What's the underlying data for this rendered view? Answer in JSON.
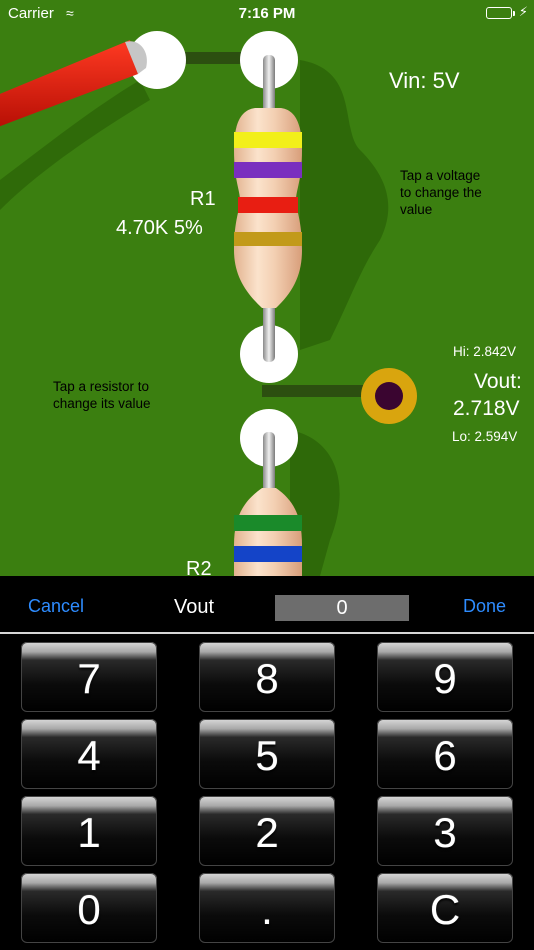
{
  "status_bar": {
    "carrier": "Carrier",
    "time": "7:16 PM",
    "battery_color": "#4cd964"
  },
  "board": {
    "background_color": "#3b7f10",
    "vin_label": "Vin: 5V",
    "vin_hint": [
      "Tap a voltage",
      "to change the",
      "value"
    ],
    "r1": {
      "name": "R1",
      "value": "4.70K 5%",
      "bands": [
        "#f2ef1a",
        "#7a2fbf",
        "#e81e12",
        "#c29a1a"
      ]
    },
    "r2": {
      "name": "R2",
      "bands": [
        "#1a8a2a",
        "#1444c8"
      ]
    },
    "resistor_hint": [
      "Tap a resistor to",
      "change its value"
    ],
    "vout": {
      "hi": "Hi: 2.842V",
      "label": "Vout:",
      "value": "2.718V",
      "lo": "Lo: 2.594V"
    },
    "probe_wire_color": "#d81a0a"
  },
  "toolbar": {
    "cancel": "Cancel",
    "field_label": "Vout",
    "value": "0",
    "done": "Done",
    "accent_color": "#2e8cff"
  },
  "keypad": {
    "keys": [
      "7",
      "8",
      "9",
      "4",
      "5",
      "6",
      "1",
      "2",
      "3",
      "0",
      ".",
      "C"
    ]
  }
}
